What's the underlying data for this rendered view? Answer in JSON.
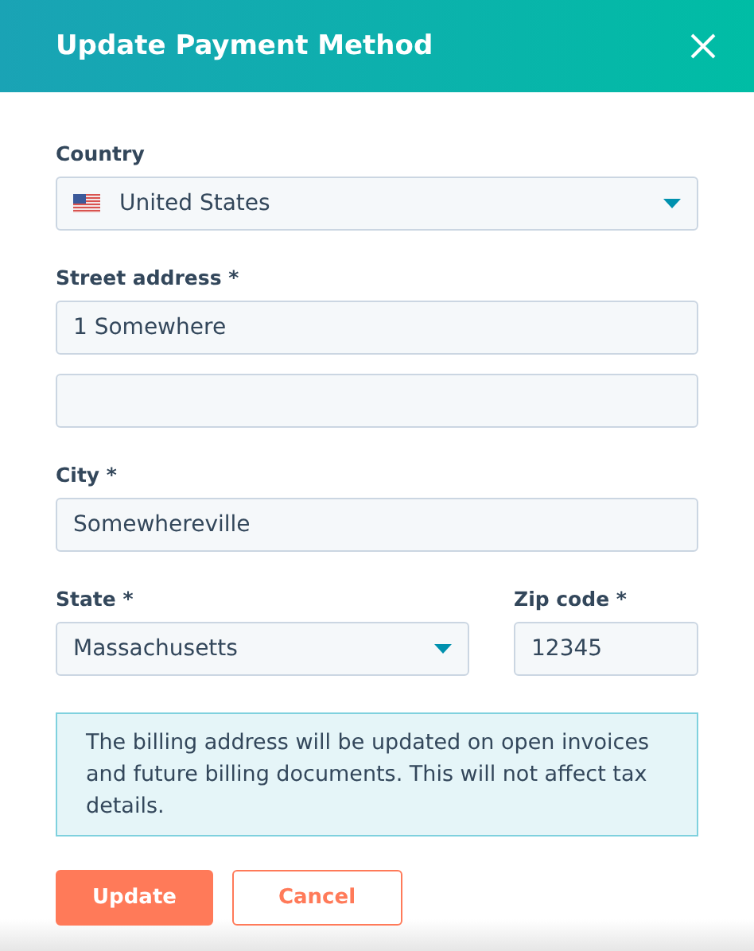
{
  "dialog": {
    "title": "Update Payment Method"
  },
  "rows": [
    {
      "fields": [
        {
          "kind": "flag-select",
          "label": "Country",
          "value": "United States"
        }
      ]
    },
    {
      "fields": [
        {
          "kind": "text",
          "label": "Street address *",
          "value": "1 Somewhere"
        }
      ]
    },
    {
      "fields": [
        {
          "kind": "text"
        }
      ]
    },
    {
      "fields": [
        {
          "kind": "text",
          "label": "City *",
          "value": "Somewhereville"
        }
      ]
    },
    {
      "fields": [
        {
          "kind": "select",
          "label": "State *",
          "value": "Massachusetts"
        },
        {
          "kind": "text",
          "label": "Zip code *",
          "value": "12345"
        }
      ]
    }
  ],
  "notice": "The billing address will be updated on open invoices and future billing documents. This will not affect tax details.",
  "buttons": [
    {
      "kind": "primary",
      "label": "Update"
    },
    {
      "kind": "secondary",
      "label": "Cancel"
    }
  ]
}
